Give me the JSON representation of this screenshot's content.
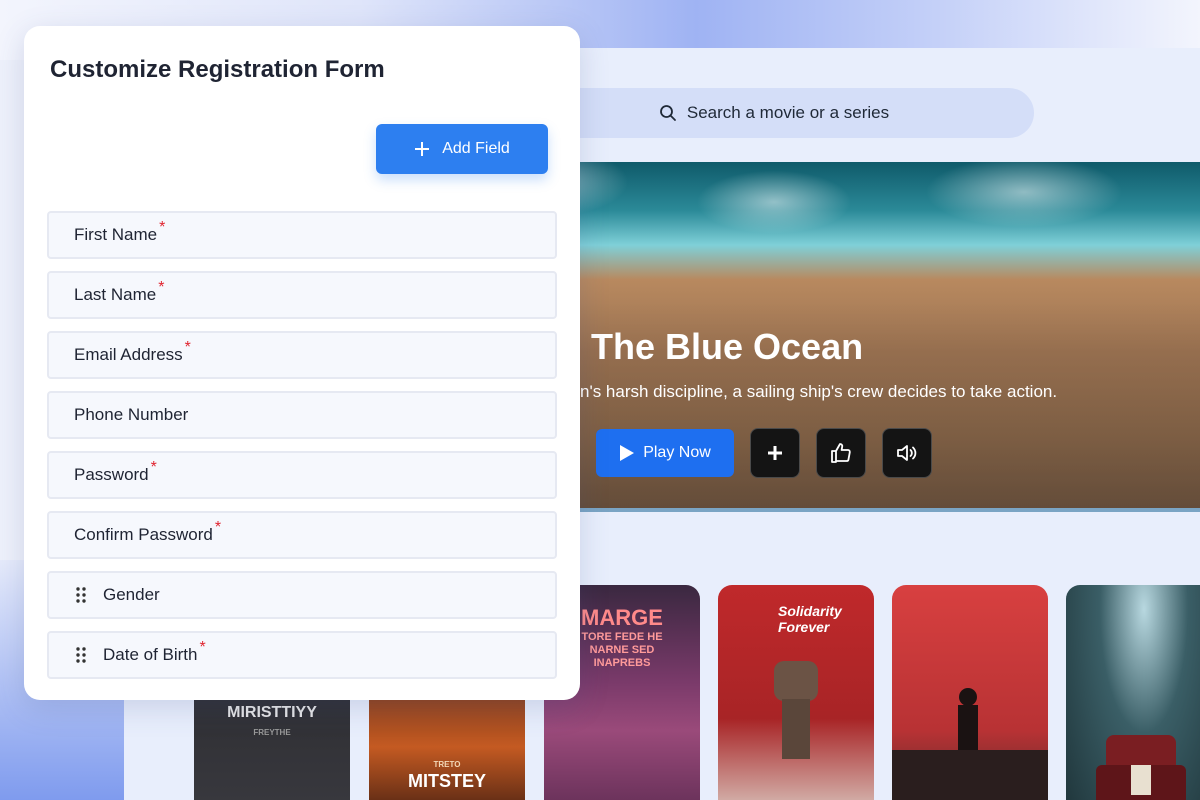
{
  "background_app": {
    "search_placeholder": "Search a movie or a series",
    "hero": {
      "title": "The Blue Ocean",
      "description": "n's harsh discipline, a sailing ship's crew decides to take action.",
      "play_label": "Play Now"
    },
    "posters": [
      {
        "title": "MIRISTTIYY",
        "subtitle": "FREYTHE"
      },
      {
        "title": "MITSTEY",
        "subtitle": "TRETO"
      },
      {
        "title": "MARGE",
        "subtitle": "TORE FEDE HE NARNE SED INAPREBS"
      },
      {
        "title": "Solidarity Forever",
        "subtitle": ""
      },
      {
        "title": "",
        "subtitle": ""
      },
      {
        "title": "",
        "subtitle": ""
      }
    ]
  },
  "form": {
    "title": "Customize Registration Form",
    "add_field_label": "Add Field",
    "fields": [
      {
        "label": "First Name",
        "required": "*"
      },
      {
        "label": "Last Name",
        "required": "*"
      },
      {
        "label": "Email Address",
        "required": "*"
      },
      {
        "label": "Phone Number",
        "required": ""
      },
      {
        "label": "Password",
        "required": "*"
      },
      {
        "label": "Confirm Password",
        "required": "*"
      },
      {
        "label": "Gender",
        "required": ""
      },
      {
        "label": "Date of Birth",
        "required": "*"
      }
    ]
  },
  "colors": {
    "primary": "#2d7ff0",
    "required": "#e0242f",
    "panel_bg": "#ffffff",
    "app_bg": "#e8eefc"
  },
  "icons": {
    "search": "search-icon",
    "add": "plus-icon",
    "play": "play-icon",
    "watchlist": "plus-icon",
    "like": "thumbs-up-icon",
    "volume": "volume-icon",
    "drag": "drag-handle-icon"
  }
}
